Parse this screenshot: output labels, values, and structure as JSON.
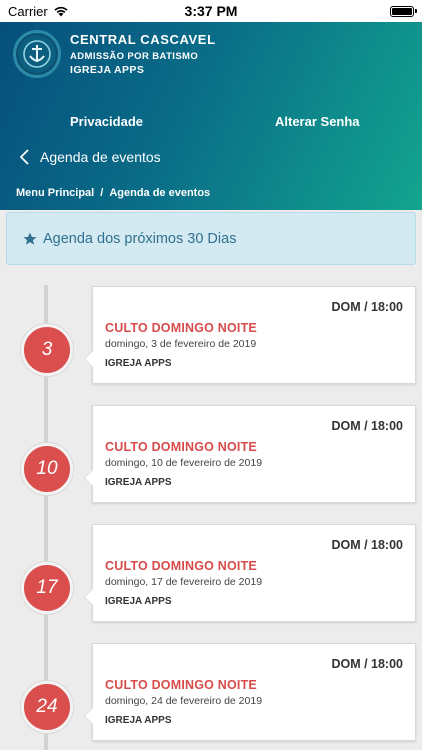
{
  "status_bar": {
    "carrier": "Carrier",
    "time": "3:37 PM"
  },
  "header": {
    "org_name": "CENTRAL CASCAVEL",
    "org_subtitle": "ADMISSÃO POR BATISMO",
    "app_name": "IGREJA APPS",
    "nav": {
      "privacy": "Privacidade",
      "change_password": "Alterar Senha"
    },
    "back_label": "Agenda de eventos",
    "breadcrumb": {
      "home": "Menu Principal",
      "separator": "/",
      "current": "Agenda de eventos"
    }
  },
  "alert": {
    "text": "Agenda dos próximos 30 Dias",
    "icon": "star-icon"
  },
  "events": [
    {
      "day": "3",
      "time": "DOM / 18:00",
      "title": "CULTO DOMINGO NOITE",
      "date": "domingo, 3 de fevereiro de 2019",
      "place": "IGREJA APPS"
    },
    {
      "day": "10",
      "time": "DOM / 18:00",
      "title": "CULTO DOMINGO NOITE",
      "date": "domingo, 10 de fevereiro de 2019",
      "place": "IGREJA APPS"
    },
    {
      "day": "17",
      "time": "DOM / 18:00",
      "title": "CULTO DOMINGO NOITE",
      "date": "domingo, 17 de fevereiro de 2019",
      "place": "IGREJA APPS"
    },
    {
      "day": "24",
      "time": "DOM / 18:00",
      "title": "CULTO DOMINGO NOITE",
      "date": "domingo, 24 de fevereiro de 2019",
      "place": "IGREJA APPS"
    }
  ],
  "colors": {
    "header_start": "#064f7c",
    "header_end": "#12a58f",
    "event_title": "#d84b4b",
    "day_badge": "#db4e4e",
    "alert_bg": "#d4eaf3",
    "alert_text": "#31708f"
  }
}
